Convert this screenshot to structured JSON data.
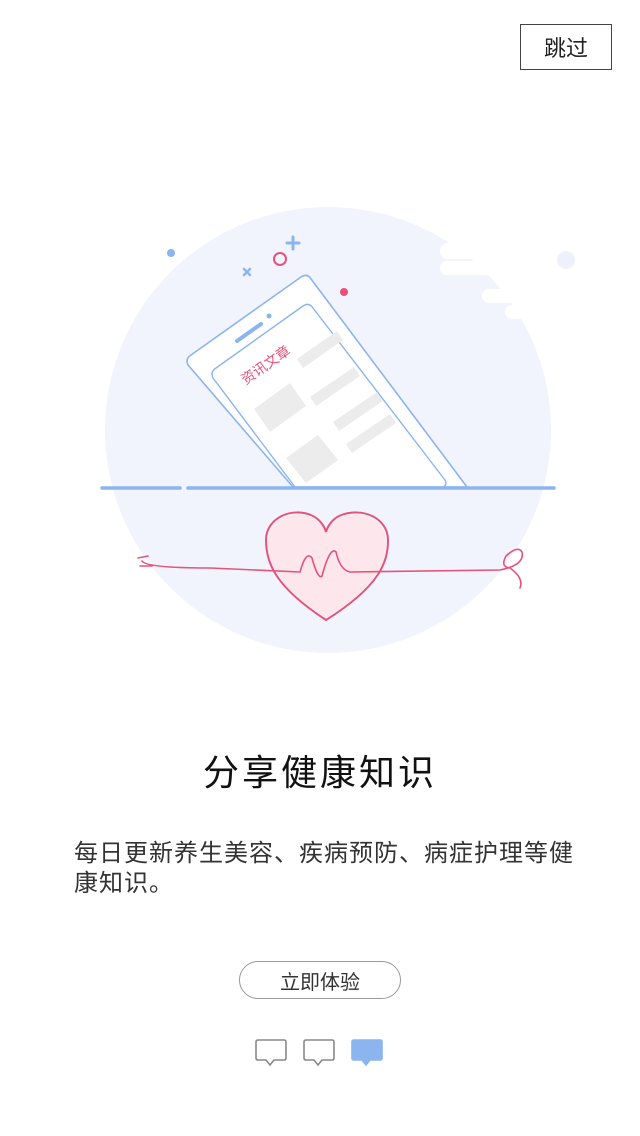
{
  "header": {
    "skip_label": "跳过"
  },
  "illustration": {
    "phone_label": "资讯文章"
  },
  "main": {
    "title": "分享健康知识",
    "description": "每日更新养生美容、疾病预防、病症护理等健康知识。",
    "cta_label": "立即体验"
  },
  "pager": {
    "total": 3,
    "active_index": 2
  },
  "colors": {
    "accent_blue": "#8cb4ee",
    "heart_pink": "#e8527a",
    "circle_bg": "#f1f4fd",
    "placeholder_gray": "#ececec"
  }
}
